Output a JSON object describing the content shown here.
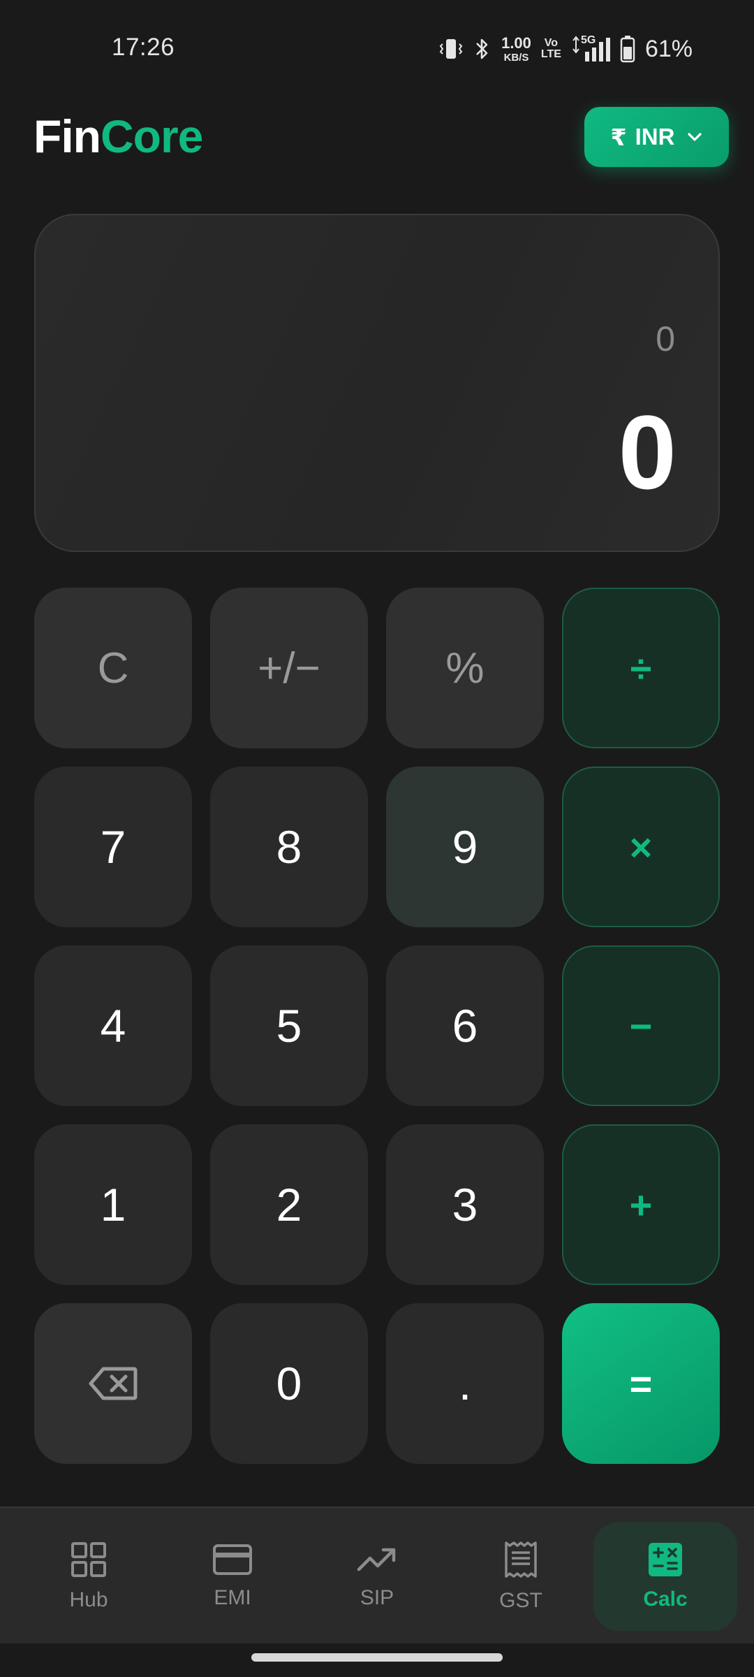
{
  "status_bar": {
    "time": "17:26",
    "net_speed_value": "1.00",
    "net_speed_unit": "KB/S",
    "volte_top": "Vo",
    "volte_bottom": "LTE",
    "network_type": "5G",
    "battery_percent": "61%"
  },
  "header": {
    "logo_part1": "Fin",
    "logo_part2": "Core",
    "currency_symbol": "₹",
    "currency_code": "INR"
  },
  "display": {
    "expression": "0",
    "result": "0"
  },
  "keypad": {
    "clear": "C",
    "sign": "+/−",
    "percent": "%",
    "divide": "÷",
    "k7": "7",
    "k8": "8",
    "k9": "9",
    "multiply": "×",
    "k4": "4",
    "k5": "5",
    "k6": "6",
    "minus": "−",
    "k1": "1",
    "k2": "2",
    "k3": "3",
    "plus": "+",
    "k0": "0",
    "dot": ".",
    "equals": "="
  },
  "bottom_nav": {
    "items": [
      {
        "label": "Hub",
        "icon": "grid-icon",
        "active": false
      },
      {
        "label": "EMI",
        "icon": "credit-card-icon",
        "active": false
      },
      {
        "label": "SIP",
        "icon": "trending-up-icon",
        "active": false
      },
      {
        "label": "GST",
        "icon": "receipt-icon",
        "active": false
      },
      {
        "label": "Calc",
        "icon": "calculator-icon",
        "active": true
      }
    ]
  },
  "colors": {
    "background": "#1a1a1a",
    "accent": "#10b981",
    "key": "#2a2a2a",
    "operator_key": "#163026"
  }
}
